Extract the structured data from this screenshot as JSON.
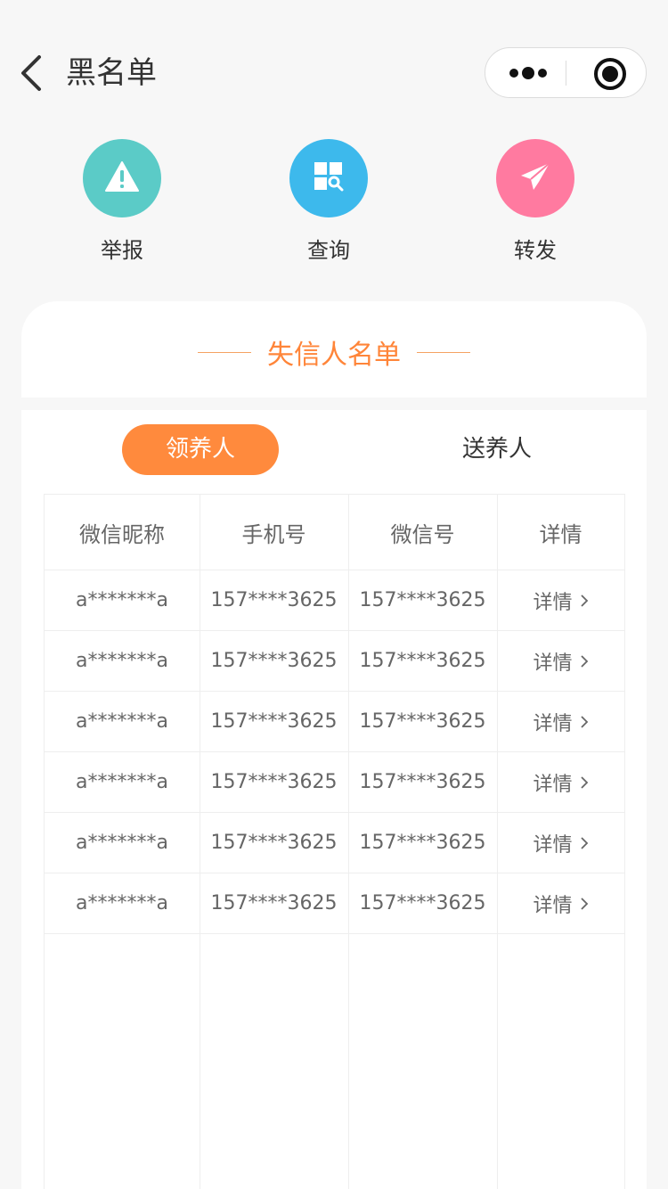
{
  "nav": {
    "title": "黑名单"
  },
  "actions": [
    {
      "label": "举报",
      "icon": "warning-icon",
      "color": "#5bcbc7"
    },
    {
      "label": "查询",
      "icon": "search-grid-icon",
      "color": "#3db9ec"
    },
    {
      "label": "转发",
      "icon": "send-icon",
      "color": "#ff7aa0"
    }
  ],
  "section": {
    "title": "失信人名单"
  },
  "tabs": {
    "active": "领养人",
    "inactive": "送养人"
  },
  "table": {
    "headers": [
      "微信昵称",
      "手机号",
      "微信号",
      "详情"
    ],
    "rows": [
      [
        "a*******a",
        "157****3625",
        "157****3625",
        "详情"
      ],
      [
        "a*******a",
        "157****3625",
        "157****3625",
        "详情"
      ],
      [
        "a*******a",
        "157****3625",
        "157****3625",
        "详情"
      ],
      [
        "a*******a",
        "157****3625",
        "157****3625",
        "详情"
      ],
      [
        "a*******a",
        "157****3625",
        "157****3625",
        "详情"
      ],
      [
        "a*******a",
        "157****3625",
        "157****3625",
        "详情"
      ]
    ]
  },
  "colors": {
    "accent": "#ff8a3d",
    "accent_text": "#ff8539"
  }
}
